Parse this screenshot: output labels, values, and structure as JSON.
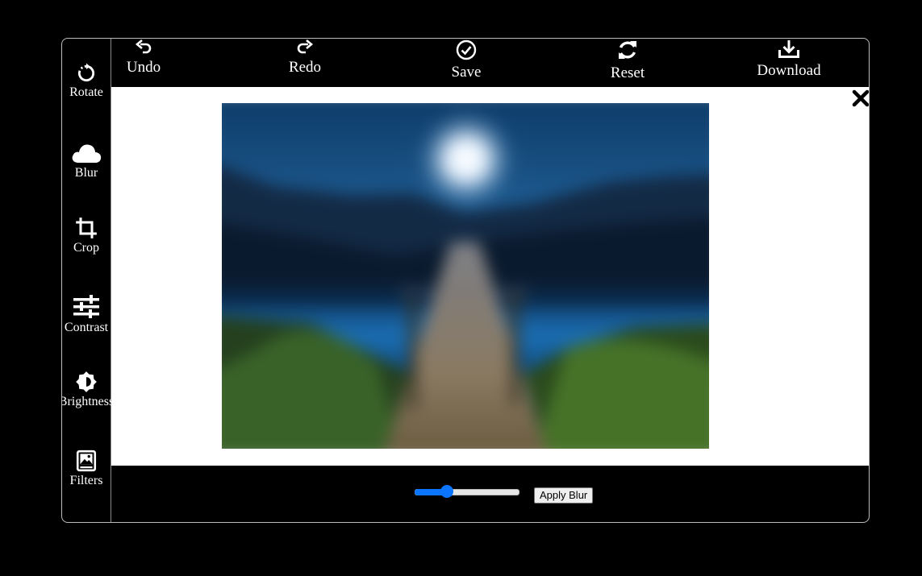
{
  "sidebar": {
    "items": [
      {
        "label": "Rotate",
        "icon": "rotate-icon"
      },
      {
        "label": "Blur",
        "icon": "cloud-icon"
      },
      {
        "label": "Crop",
        "icon": "crop-icon"
      },
      {
        "label": "Contrast",
        "icon": "sliders-icon"
      },
      {
        "label": "Brightness",
        "icon": "brightness-icon"
      },
      {
        "label": "Filters",
        "icon": "image-icon"
      }
    ]
  },
  "toolbar": {
    "items": [
      {
        "label": "Undo",
        "icon": "undo-icon"
      },
      {
        "label": "Redo",
        "icon": "redo-icon"
      },
      {
        "label": "Save",
        "icon": "check-circle-icon"
      },
      {
        "label": "Reset",
        "icon": "refresh-icon"
      },
      {
        "label": "Download",
        "icon": "download-icon"
      }
    ]
  },
  "canvas": {
    "close_icon": "close-icon",
    "image_subject": "blurred night lake with wooden pier and moon"
  },
  "controls": {
    "blur_slider_fraction": 0.31,
    "apply_label": "Apply Blur"
  },
  "colors": {
    "background": "#000000",
    "canvas": "#ffffff",
    "accent": "#0b75ff",
    "border": "#bdbdbd"
  }
}
